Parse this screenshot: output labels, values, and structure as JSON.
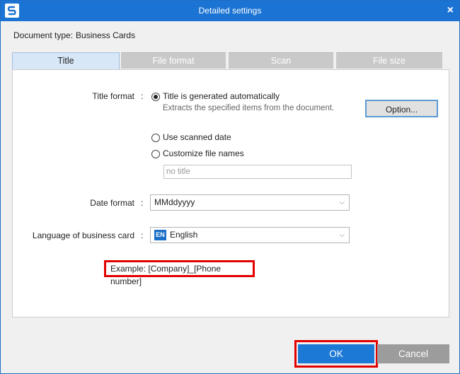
{
  "window": {
    "title": "Detailed settings",
    "close_glyph": "×",
    "app_icon": "scansnap-s-icon"
  },
  "doctype": {
    "label": "Document type:",
    "value": "Business Cards"
  },
  "tabs": [
    {
      "label": "Title",
      "active": true
    },
    {
      "label": "File format",
      "active": false
    },
    {
      "label": "Scan",
      "active": false
    },
    {
      "label": "File size",
      "active": false
    }
  ],
  "title_format": {
    "label": "Title format",
    "colon": ":",
    "options": [
      {
        "label": "Title is generated automatically",
        "checked": true
      },
      {
        "label": "Use scanned date",
        "checked": false
      },
      {
        "label": "Customize file names",
        "checked": false
      }
    ],
    "auto_hint": "Extracts the specified items from the document.",
    "option_button": "Option...",
    "custom_name_placeholder": "no title"
  },
  "date_format": {
    "label": "Date format",
    "colon": ":",
    "value": "MMddyyyy"
  },
  "language": {
    "label": "Language of business card",
    "colon": ":",
    "badge": "EN",
    "value": "English"
  },
  "example": {
    "label": "Example:",
    "value": "[Company]_[Phone number]"
  },
  "footer": {
    "ok": "OK",
    "cancel": "Cancel"
  },
  "colors": {
    "titlebar": "#1b73d3",
    "ok_button": "#1c79d6",
    "cancel_button": "#9c9c9c",
    "highlight": "#e30000",
    "active_tab": "#d8e7f7"
  }
}
